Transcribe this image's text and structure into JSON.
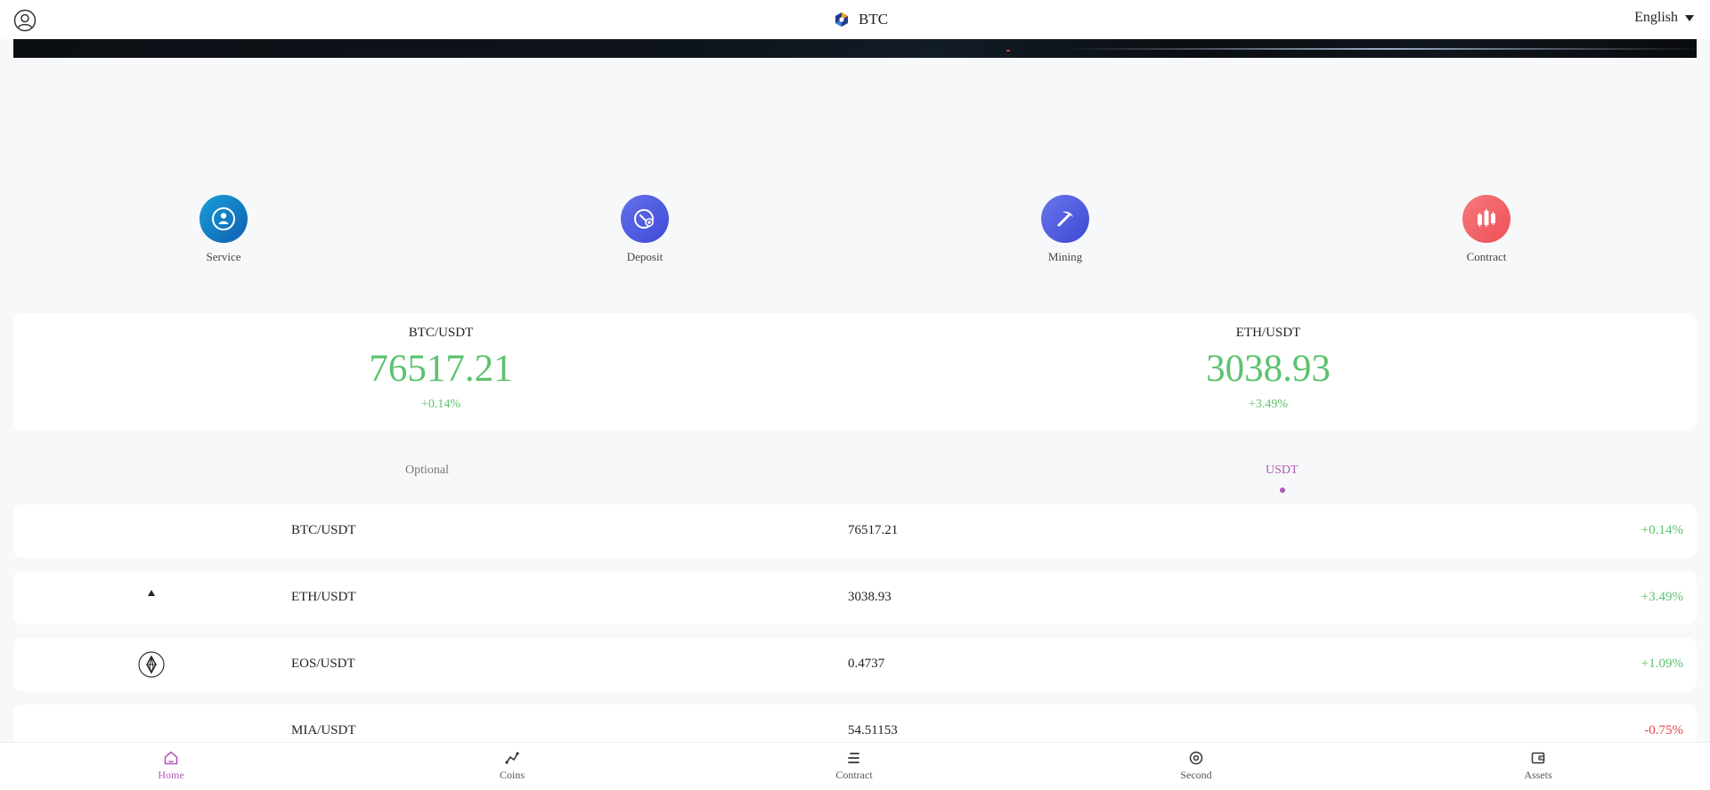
{
  "header": {
    "brand_title": "BTC",
    "language": "English"
  },
  "quick_actions": [
    {
      "label": "Service",
      "icon": "service-icon",
      "color_from": "#1a9ed9",
      "color_to": "#0e5fb0"
    },
    {
      "label": "Deposit",
      "icon": "deposit-icon",
      "color_from": "#6470ea",
      "color_to": "#3f4bd6"
    },
    {
      "label": "Mining",
      "icon": "mining-icon",
      "color_from": "#6a75ec",
      "color_to": "#3d49d2"
    },
    {
      "label": "Contract",
      "icon": "contract-icon",
      "color_from": "#f57a7e",
      "color_to": "#ee4f56"
    }
  ],
  "tickers": [
    {
      "pair": "BTC/USDT",
      "price": "76517.21",
      "change": "+0.14%"
    },
    {
      "pair": "ETH/USDT",
      "price": "3038.93",
      "change": "+3.49%"
    }
  ],
  "tabs": {
    "optional": "Optional",
    "usdt": "USDT",
    "active": "USDT"
  },
  "markets": [
    {
      "pair": "BTC/USDT",
      "price": "76517.21",
      "change": "+0.14%",
      "direction": "up",
      "icon": "none"
    },
    {
      "pair": "ETH/USDT",
      "price": "3038.93",
      "change": "+3.49%",
      "direction": "up",
      "icon": "eth-icon"
    },
    {
      "pair": "EOS/USDT",
      "price": "0.4737",
      "change": "+1.09%",
      "direction": "up",
      "icon": "eos-icon"
    },
    {
      "pair": "MIA/USDT",
      "price": "54.51153",
      "change": "-0.75%",
      "direction": "down",
      "icon": "none"
    }
  ],
  "nav": [
    {
      "label": "Home",
      "icon": "home-icon",
      "active": true
    },
    {
      "label": "Coins",
      "icon": "coins-icon",
      "active": false
    },
    {
      "label": "Contract",
      "icon": "contract-nav-icon",
      "active": false
    },
    {
      "label": "Second",
      "icon": "second-icon",
      "active": false
    },
    {
      "label": "Assets",
      "icon": "wallet-icon",
      "active": false
    }
  ],
  "colors": {
    "accent": "#b05ab6",
    "up": "#5cc26e",
    "down": "#e0464a"
  }
}
